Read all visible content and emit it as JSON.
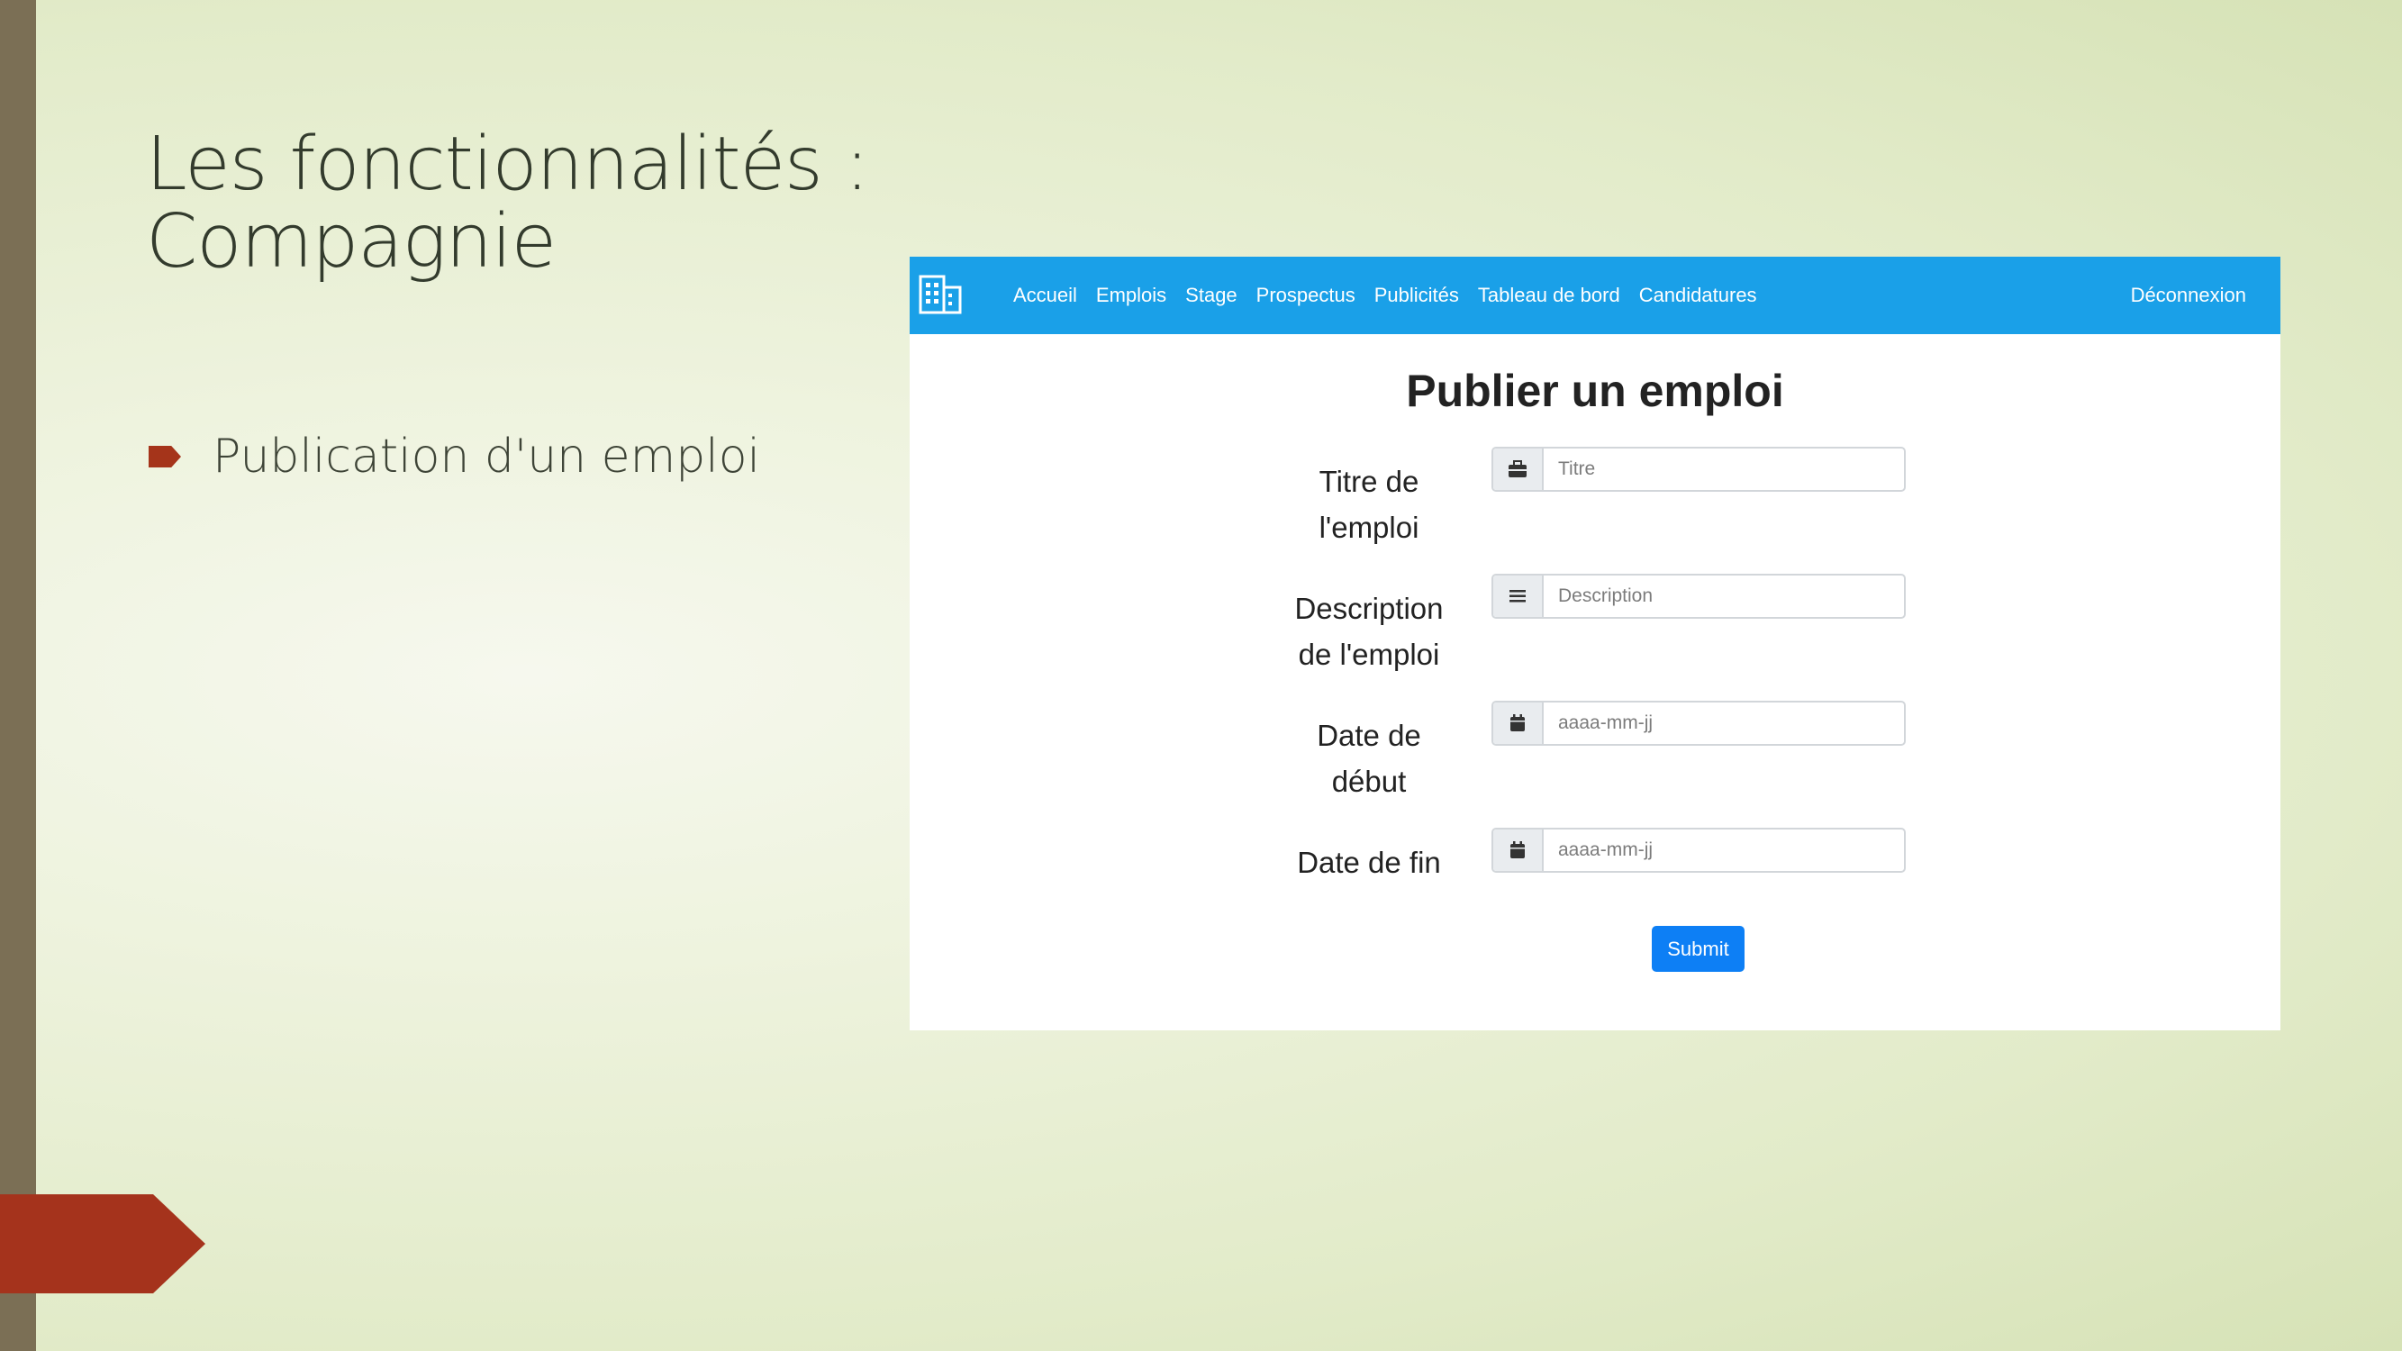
{
  "slide": {
    "title_line1": "Les fonctionnalités :",
    "title_line2": "Compagnie",
    "bullet": "Publication d'un emploi"
  },
  "app": {
    "nav": {
      "brand_icon": "building-icon",
      "links": [
        "Accueil",
        "Emplois",
        "Stage",
        "Prospectus",
        "Publicités",
        "Tableau de bord",
        "Candidatures"
      ],
      "logout": "Déconnexion"
    },
    "form": {
      "title": "Publier un emploi",
      "fields": [
        {
          "label_line1": "Titre de",
          "label_line2": "l'emploi",
          "icon": "briefcase-icon",
          "placeholder": "Titre"
        },
        {
          "label_line1": "Description",
          "label_line2": "de l'emploi",
          "icon": "list-icon",
          "placeholder": "Description"
        },
        {
          "label_line1": "Date de",
          "label_line2": "début",
          "icon": "calendar-icon",
          "placeholder": "aaaa-mm-jj"
        },
        {
          "label_line1": "Date de fin",
          "label_line2": "",
          "icon": "calendar-icon",
          "placeholder": "aaaa-mm-jj"
        }
      ],
      "submit": "Submit"
    }
  },
  "colors": {
    "navbar": "#1aa0e8",
    "submit": "#0d7ff5",
    "accent_red": "#a5341a",
    "left_bar": "#7b6f55"
  }
}
